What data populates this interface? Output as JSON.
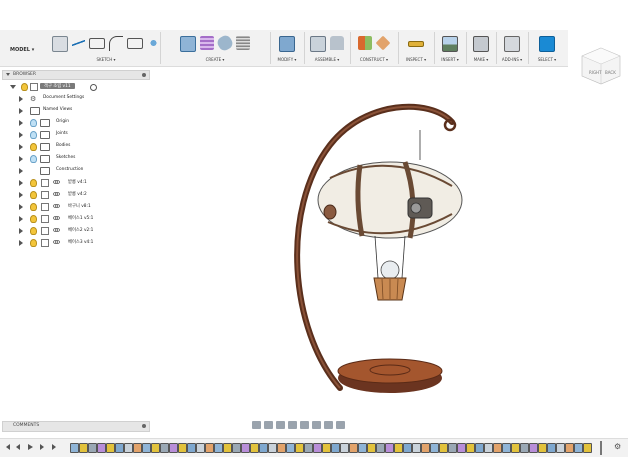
{
  "toolbar": {
    "mode_label": "MODEL",
    "groups": [
      {
        "label": "SKETCH",
        "icons": [
          "sketch-icon",
          "line-icon",
          "rectangle-icon",
          "arc-icon",
          "image-icon",
          "pattern-icon"
        ]
      },
      {
        "label": "CREATE",
        "icons": [
          "extrude-icon",
          "grid-icon",
          "cylinder-icon",
          "coil-icon"
        ]
      },
      {
        "label": "MODIFY",
        "icons": [
          "press-pull-icon"
        ]
      },
      {
        "label": "ASSEMBLE",
        "icons": [
          "component-icon",
          "joint-icon"
        ]
      },
      {
        "label": "CONSTRUCT",
        "icons": [
          "plane-icon",
          "axis-icon"
        ]
      },
      {
        "label": "INSPECT",
        "icons": [
          "measure-icon"
        ]
      },
      {
        "label": "INSERT",
        "icons": [
          "insert-image-icon"
        ]
      },
      {
        "label": "MAKE",
        "icons": [
          "print-icon"
        ]
      },
      {
        "label": "ADD-INS",
        "icons": [
          "scripts-icon"
        ]
      },
      {
        "label": "SELECT",
        "icons": [
          "select-cursor-icon"
        ]
      }
    ]
  },
  "viewcube": {
    "right_label": "RIGHT",
    "back_label": "BACK"
  },
  "browser": {
    "title": "BROWSER",
    "root": "객구 조립 v11",
    "items": [
      {
        "label": "Document Settings",
        "kind": "gear"
      },
      {
        "label": "Named Views",
        "kind": "folder"
      },
      {
        "label": "Origin",
        "kind": "folder"
      },
      {
        "label": "Joints",
        "kind": "folder"
      },
      {
        "label": "Bodies",
        "kind": "folder"
      },
      {
        "label": "Sketches",
        "kind": "folder"
      },
      {
        "label": "Construction",
        "kind": "folder"
      },
      {
        "label": "받롱 v4:1",
        "kind": "component"
      },
      {
        "label": "받롱 v4:2",
        "kind": "component"
      },
      {
        "label": "바구니 v8:1",
        "kind": "component"
      },
      {
        "label": "베이스1 v5:1",
        "kind": "component"
      },
      {
        "label": "베이스2 v2:1",
        "kind": "component"
      },
      {
        "label": "베이스3 v4:1",
        "kind": "component"
      }
    ]
  },
  "comments": {
    "title": "COMMENTS"
  },
  "colors": {
    "accent_blue": "#1a8ad4",
    "stand_brown": "#6b3a24",
    "balloon_white": "#f1ede4",
    "toolbar_bg": "#f2f2f2"
  }
}
